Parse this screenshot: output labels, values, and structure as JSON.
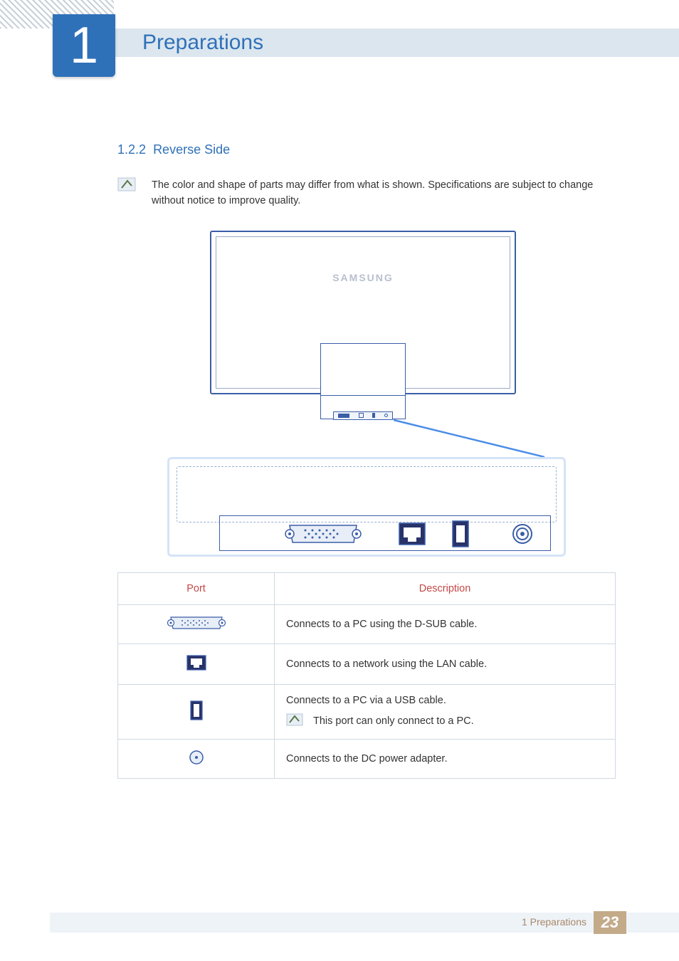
{
  "header": {
    "chapter_number": "1",
    "chapter_title": "Preparations"
  },
  "subsection": {
    "number": "1.2.2",
    "title": "Reverse Side"
  },
  "note": "The color and shape of parts may differ from what is shown. Specifications are subject to change without notice to improve quality.",
  "monitor_logo": "SAMSUNG",
  "table": {
    "headers": {
      "port": "Port",
      "description": "Description"
    },
    "rows": [
      {
        "desc": "Connects to a PC using the D-SUB cable."
      },
      {
        "desc": "Connects to a network using the LAN cable."
      },
      {
        "desc": "Connects to a PC via a USB cable.",
        "subnote": "This port can only connect to a PC."
      },
      {
        "desc": "Connects to the DC power adapter."
      }
    ]
  },
  "footer": {
    "label": "1 Preparations",
    "page": "23"
  }
}
